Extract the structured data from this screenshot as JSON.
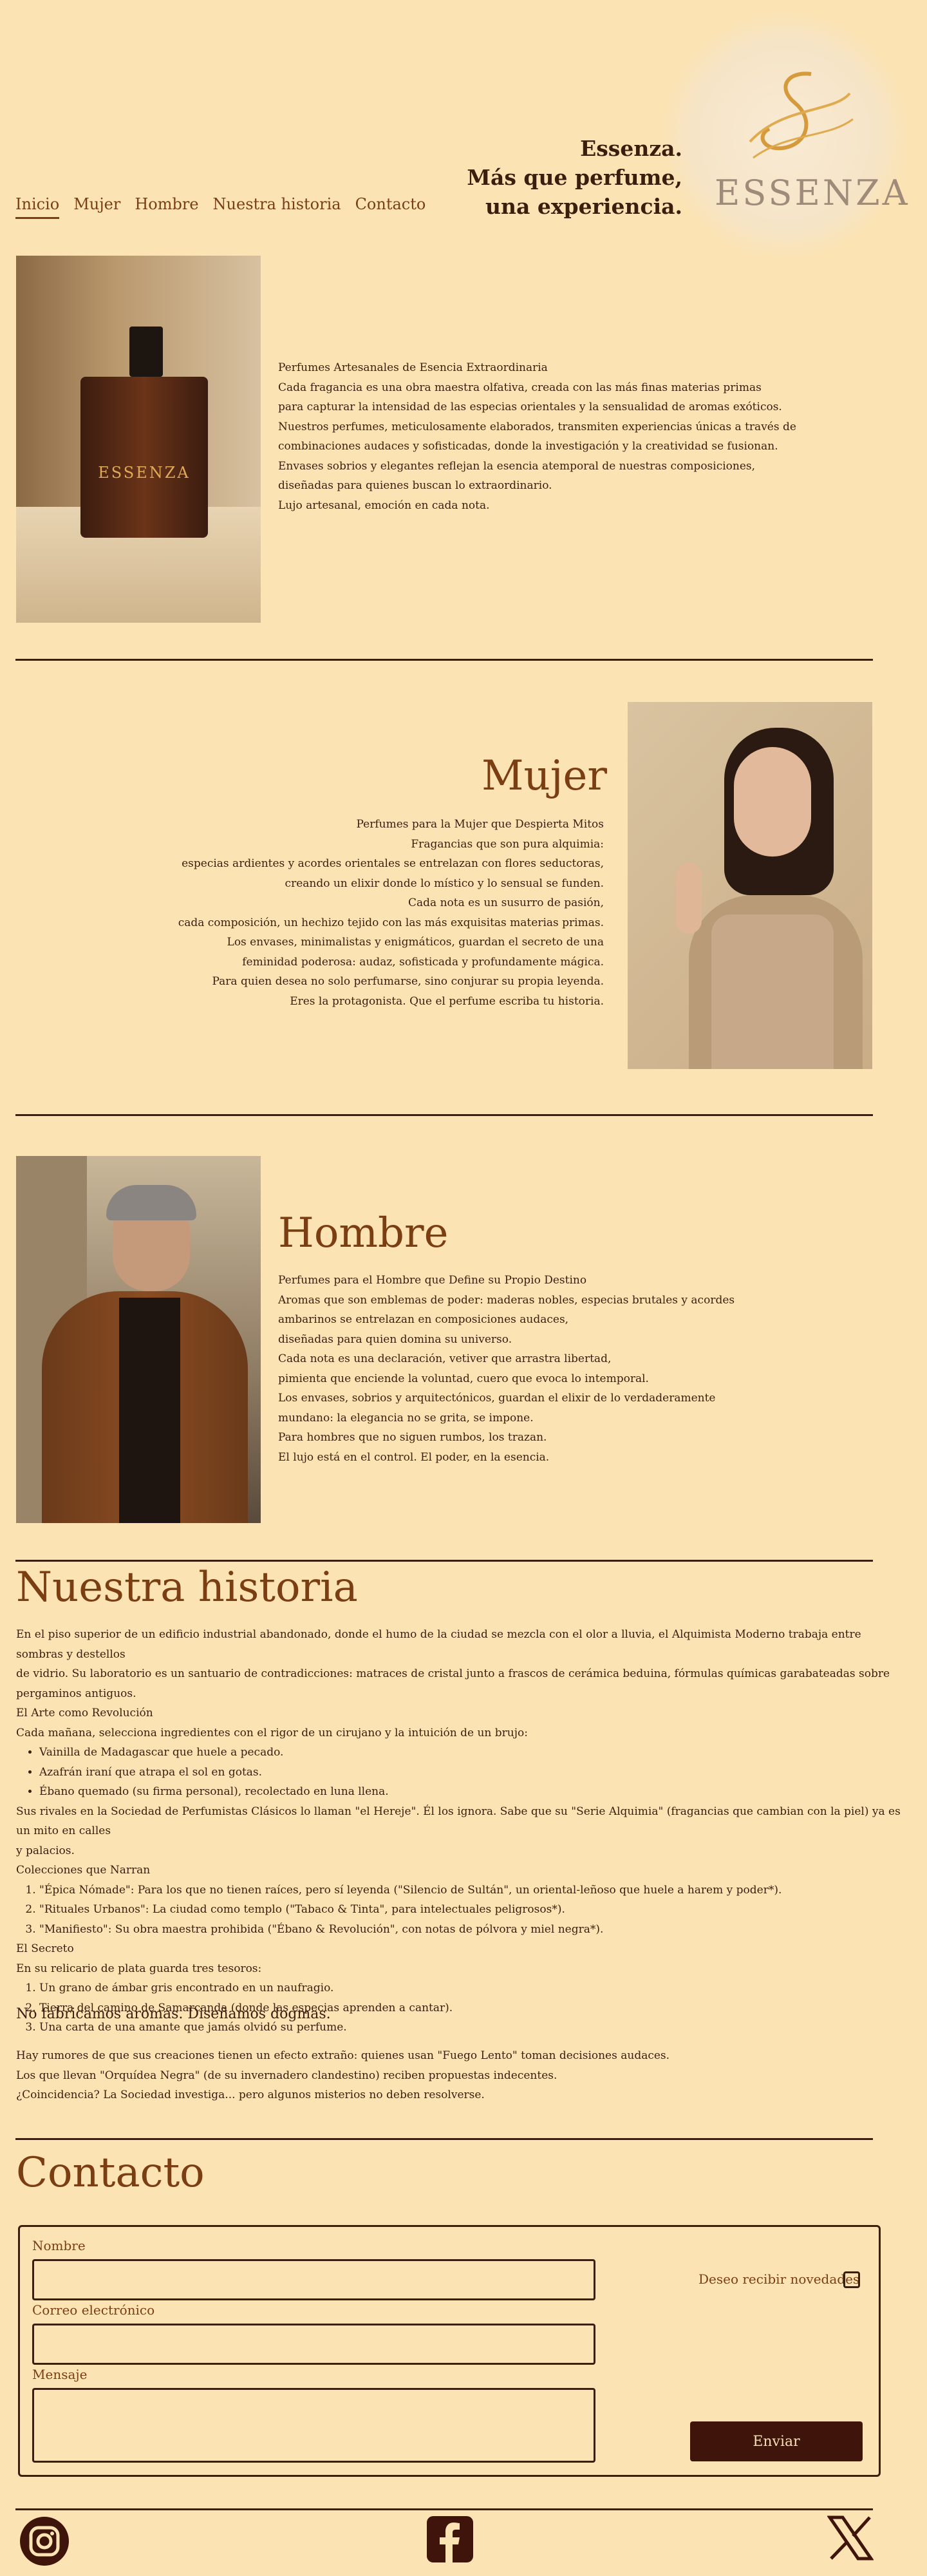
{
  "header": {
    "nav": [
      "Inicio",
      "Mujer",
      "Hombre",
      "Nuestra historia",
      "Contacto"
    ],
    "tagline": [
      "Essenza.",
      "Más que perfume,",
      "una experiencia."
    ],
    "logo_text": "ESSENZA"
  },
  "intro": {
    "bottle_label": "ESSENZA",
    "lines": [
      "Perfumes Artesanales de Esencia Extraordinaria",
      "Cada fragancia es una obra maestra olfativa, creada con las más finas  materias primas",
      "para capturar la intensidad de las especias orientales y la sensualidad de aromas exóticos.",
      "Nuestros perfumes, meticulosamente  elaborados, transmiten experiencias únicas a través de",
      "combinaciones  audaces y sofisticadas, donde la investigación y la creatividad se  fusionan.",
      "Envases sobrios y elegantes reflejan la esencia atemporal de  nuestras composiciones,",
      "diseñadas para quienes buscan lo extraordinario.",
      "Lujo artesanal, emoción en cada nota."
    ]
  },
  "mujer": {
    "title": "Mujer",
    "lines": [
      "Perfumes para la Mujer que Despierta Mitos",
      "Fragancias que son pura alquimia:",
      "especias ardientes y acordes  orientales se entrelazan con flores seductoras,",
      "creando un elixir donde  lo místico y lo sensual se funden.",
      "Cada nota es un susurro de pasión,",
      "cada composición, un hechizo tejido con las más exquisitas materias  primas.",
      "Los envases, minimalistas y enigmáticos, guardan el secreto de  una",
      "feminidad poderosa: audaz, sofisticada y profundamente mágica.",
      "Para quien desea no solo perfumarse, sino conjurar su propia leyenda.",
      "Eres la protagonista. Que el perfume escriba tu historia."
    ]
  },
  "hombre": {
    "title": "Hombre",
    "lines": [
      "Perfumes para el Hombre que Define su Propio Destino",
      "Aromas que son emblemas de poder: maderas nobles, especias brutales y  acordes",
      "ambarinos se entrelazan en composiciones audaces,",
      "diseñadas para quien domina su universo.",
      "Cada nota es una declaración, vetiver que  arrastra libertad,",
      "pimienta que enciende la voluntad, cuero que evoca lo intemporal.",
      "Los envases, sobrios y arquitectónicos, guardan el elixir  de lo verdaderamente",
      "mundano: la elegancia no se grita, se impone.",
      "Para hombres que no siguen rumbos, los trazan.",
      "El lujo está en el control. El poder, en la esencia."
    ]
  },
  "historia": {
    "title": "Nuestra historia",
    "p1": "En el piso superior de un edificio industrial abandonado, donde el humo de la ciudad se mezcla con el olor a lluvia, el Alquimista Moderno trabaja entre sombras y destellos",
    "p1b": "de vidrio. Su laboratorio es un  santuario de contradicciones: matraces de cristal junto a frascos de  cerámica beduina, fórmulas químicas garabateadas sobre pergaminos  antiguos.",
    "h1": "El Arte como Revolución",
    "p2": "Cada mañana, selecciona ingredientes con el rigor de un cirujano y la intuición de un brujo:",
    "bullets": [
      "Vainilla de Madagascar que huele a pecado.",
      "Azafrán iraní que atrapa el sol en gotas.",
      "Ébano quemado (su firma personal), recolectado en luna llena."
    ],
    "p3": "Sus rivales en la Sociedad de Perfumistas Clásicos lo llaman \"el Hereje\". Él los ignora. Sabe que su \"Serie Alquimia\" (fragancias que cambian con la piel) ya es un mito en calles",
    "p3b": "y palacios.",
    "h2": "Colecciones que Narran",
    "collections": [
      "\"Épica Nómade\": Para los que no tienen raíces, pero sí leyenda (\"Silencio de Sultán\", un oriental-leñoso que huele a harem y poder*).",
      "\"Rituales Urbanos\": La ciudad como templo (\"Tabaco & Tinta\", para intelectuales peligrosos*).",
      "\"Manifiesto\": Su obra maestra prohibida (\"Ébano & Revolución\", con notas de pólvora y miel negra*)."
    ],
    "h3": "El Secreto",
    "p4": "En su relicario de plata guarda tres tesoros:",
    "treasures": [
      "Un grano de ámbar gris encontrado en un naufragio.",
      "Tierra del camino de Samarcanda (donde las especias aprenden a cantar).",
      "Una carta de una amante que jamás olvidó su perfume."
    ],
    "motto": "No fabricamos aromas. Diseñamos dogmas.",
    "rumors": [
      "Hay rumores de que sus creaciones tienen un efecto extraño: quienes usan \"Fuego Lento\" toman decisiones audaces.",
      "Los que llevan \"Orquídea Negra\" (de su invernadero clandestino) reciben propuestas indecentes.",
      "¿Coincidencia? La Sociedad investiga... pero algunos misterios no deben resolverse."
    ]
  },
  "contacto": {
    "title": "Contacto",
    "name_label": "Nombre",
    "email_label": "Correo electrónico",
    "message_label": "Mensaje",
    "newsletter_label": "Deseo recibir novedades",
    "send_label": "Enviar"
  },
  "colors": {
    "background": "#fbe3b3",
    "accent_brown": "#7a3e12",
    "dark": "#3a1f0e",
    "button": "#3f150b"
  }
}
